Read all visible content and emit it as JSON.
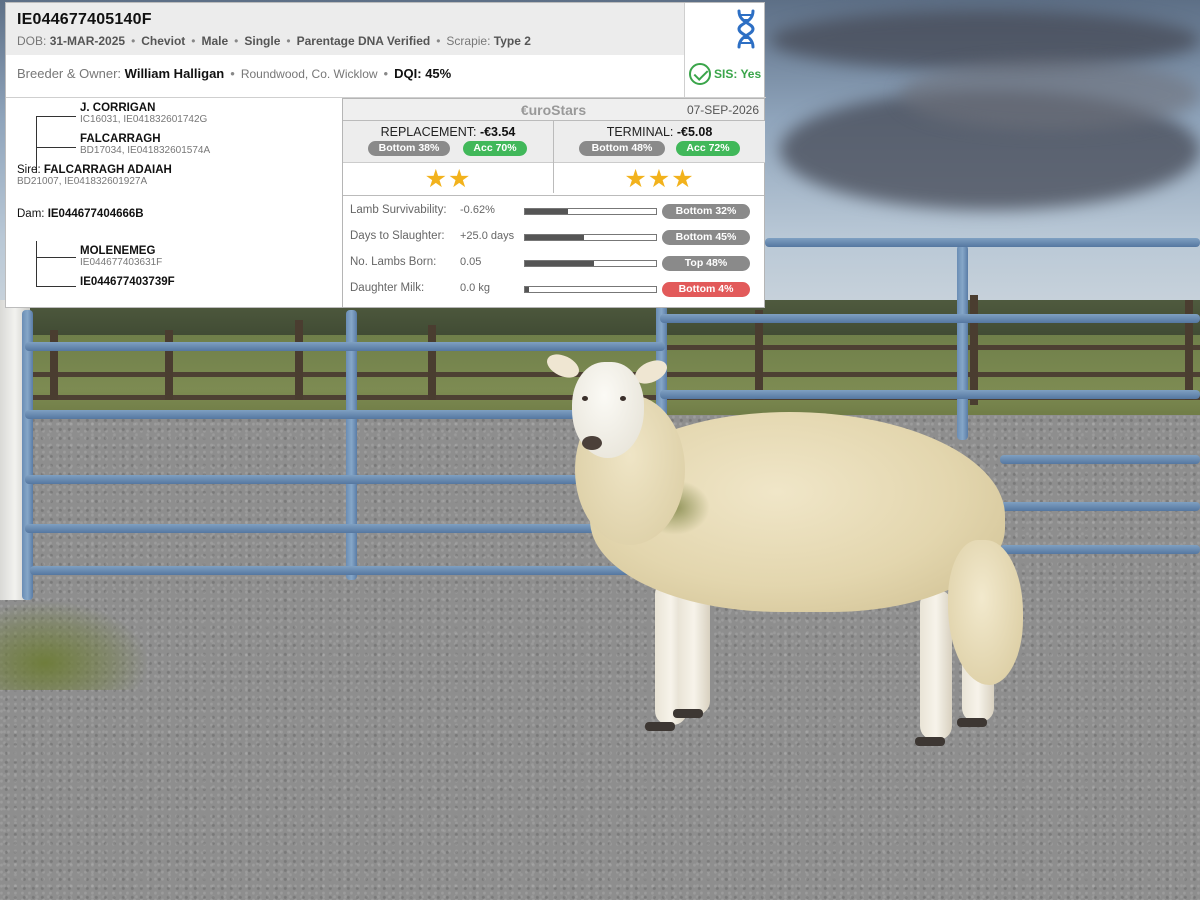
{
  "animal": {
    "id": "IE044677405140F",
    "dob_label": "DOB:",
    "dob": "31-MAR-2025",
    "breed": "Cheviot",
    "sex": "Male",
    "birth_type": "Single",
    "parentage": "Parentage DNA Verified",
    "scrapie_label": "Scrapie:",
    "scrapie": "Type 2",
    "breeder_label": "Breeder & Owner:",
    "breeder": "William Halligan",
    "location": "Roundwood, Co. Wicklow",
    "dqi_label": "DQI:",
    "dqi": "45%",
    "sis": "SIS: Yes"
  },
  "pedigree": {
    "sire_label": "Sire:",
    "dam_label": "Dam:",
    "sire_sire": {
      "name": "J. CORRIGAN",
      "ids": "IC16031, IE041832601742G"
    },
    "sire_dam": {
      "name": "FALCARRAGH",
      "ids": "BD17034, IE041832601574A"
    },
    "sire": {
      "name": "FALCARRAGH ADAIAH",
      "ids": "BD21007, IE041832601927A"
    },
    "dam": {
      "name": "IE044677404666B"
    },
    "dam_sire": {
      "name": "MOLENEMEG",
      "ids": "IE044677403631F"
    },
    "dam_dam": {
      "name": "IE044677403739F"
    }
  },
  "eurostars": {
    "title": "€uroStars",
    "date": "07-SEP-2026",
    "replacement": {
      "label": "REPLACEMENT:",
      "value": "-€3.54",
      "rank": "Bottom 38%",
      "acc": "Acc 70%",
      "stars": "★★",
      "star_count": 2
    },
    "terminal": {
      "label": "TERMINAL:",
      "value": "-€5.08",
      "rank": "Bottom 48%",
      "acc": "Acc 72%",
      "stars": "★★★",
      "star_count": 3
    },
    "traits": [
      {
        "name": "Lamb Survivability:",
        "value": "-0.62%",
        "rank": "Bottom 32%",
        "level": 0.33,
        "rank_color": "grey"
      },
      {
        "name": "Days to Slaughter:",
        "value": "+25.0 days",
        "rank": "Bottom 45%",
        "level": 0.45,
        "rank_color": "grey"
      },
      {
        "name": "No. Lambs Born:",
        "value": "0.05",
        "rank": "Top 48%",
        "level": 0.53,
        "rank_color": "grey"
      },
      {
        "name": "Daughter Milk:",
        "value": "0.0 kg",
        "rank": "Bottom 4%",
        "level": 0.03,
        "rank_color": "red"
      }
    ]
  },
  "icons": {
    "dna": "dna-icon",
    "check": "check-circle-icon",
    "star": "star-icon"
  },
  "colors": {
    "accent_green": "#41b85a",
    "warning_red": "#e25a5a",
    "neutral_pill": "#8a8a8a",
    "star_gold": "#f2b21c",
    "dna_blue": "#2d6fc4"
  }
}
